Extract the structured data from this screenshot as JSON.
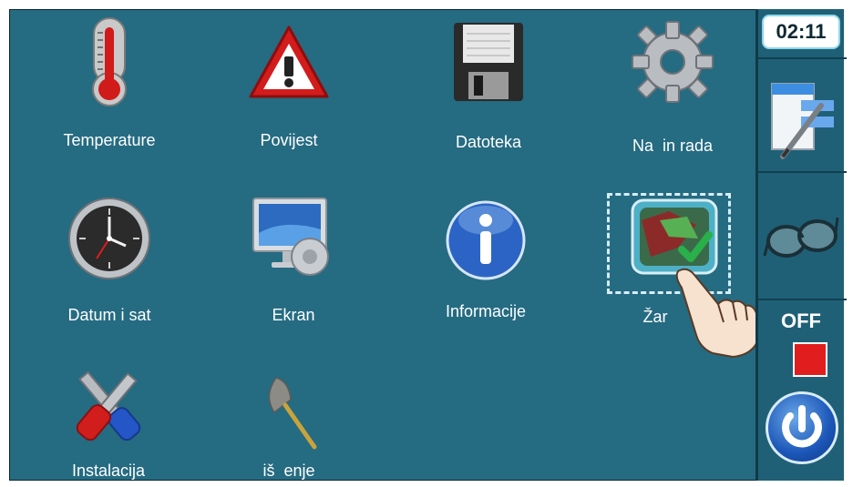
{
  "sidebar": {
    "clock": "02:11",
    "status": "OFF"
  },
  "menu": [
    {
      "label": "Temperature",
      "icon": "thermometer-icon"
    },
    {
      "label": "Povijest",
      "icon": "warning-icon"
    },
    {
      "label": "Datoteka",
      "icon": "floppy-disk-icon"
    },
    {
      "label": "Na  in rada",
      "icon": "gear-icon"
    },
    {
      "label": "Datum i sat",
      "icon": "clock-icon"
    },
    {
      "label": "Ekran",
      "icon": "monitor-settings-icon"
    },
    {
      "label": "Informacije",
      "icon": "info-icon"
    },
    {
      "label": "Žar",
      "icon": "grate-icon"
    },
    {
      "label": "Instalacija",
      "icon": "tools-icon"
    },
    {
      "label": "iš  enje",
      "icon": "duster-icon"
    }
  ],
  "colors": {
    "background": "#256b82",
    "sidebar": "#1f6077",
    "stop": "#e11d1d",
    "power": "#1c56b8"
  }
}
